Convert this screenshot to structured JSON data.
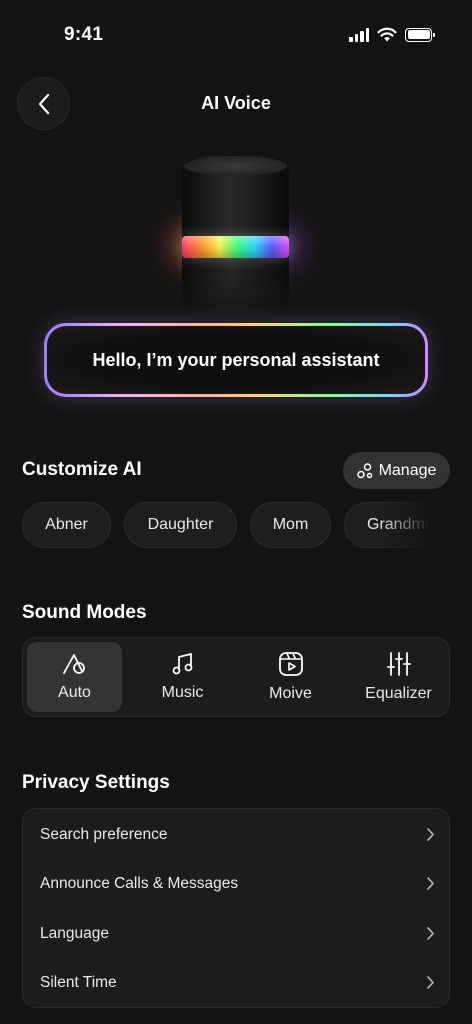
{
  "status_bar": {
    "time": "9:41"
  },
  "header": {
    "title": "AI Voice"
  },
  "greeting": "Hello, I’m your personal assistant",
  "customize": {
    "title": "Customize AI",
    "manage_label": "Manage",
    "chips": [
      "Abner",
      "Daughter",
      "Mom",
      "Grandma"
    ]
  },
  "sound_modes": {
    "title": "Sound Modes",
    "items": [
      {
        "label": "Auto",
        "icon": "auto-mode-icon",
        "active": true
      },
      {
        "label": "Music",
        "icon": "music-note-icon",
        "active": false
      },
      {
        "label": "Moive",
        "icon": "movie-play-icon",
        "active": false
      },
      {
        "label": "Equalizer",
        "icon": "equalizer-sliders-icon",
        "active": false
      }
    ]
  },
  "privacy": {
    "title": "Privacy Settings",
    "items": [
      {
        "label": "Search preference"
      },
      {
        "label": "Announce Calls & Messages"
      },
      {
        "label": "Language"
      },
      {
        "label": "Silent Time"
      }
    ]
  },
  "colors": {
    "background": "#131313",
    "card": "#1c1c1c",
    "active": "#343434"
  }
}
